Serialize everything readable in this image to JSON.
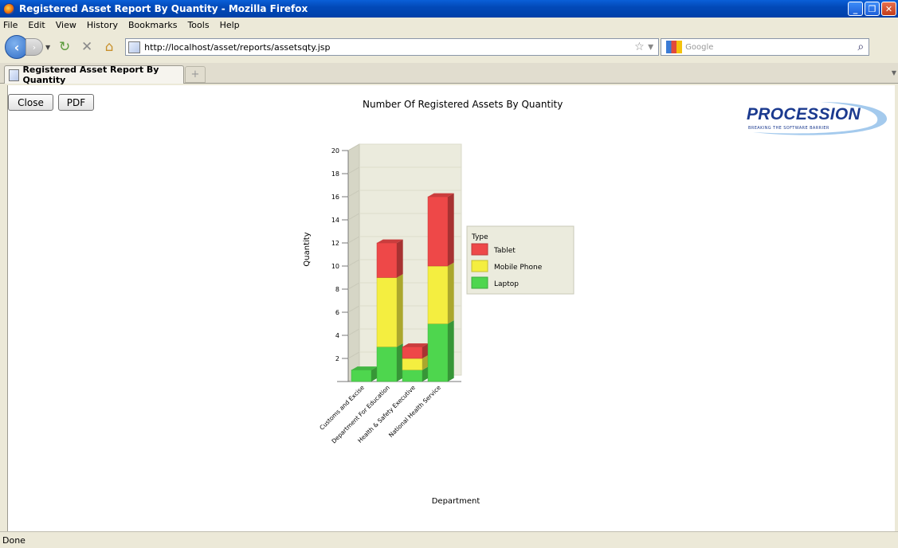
{
  "window": {
    "title": "Registered Asset Report By Quantity - Mozilla Firefox"
  },
  "menu": [
    "File",
    "Edit",
    "View",
    "History",
    "Bookmarks",
    "Tools",
    "Help"
  ],
  "nav": {
    "url": "http://localhost/asset/reports/assetsqty.jsp",
    "search_placeholder": "Google"
  },
  "tab": {
    "label": "Registered Asset Report By Quantity"
  },
  "page": {
    "close_label": "Close",
    "pdf_label": "PDF"
  },
  "logo": {
    "name": "PROCESSION",
    "tagline": "BREAKING THE SOFTWARE BARRIER"
  },
  "status": "Done",
  "chart_data": {
    "type": "bar",
    "stacked": true,
    "title": "Number Of Registered Assets By Quantity",
    "xlabel": "Department",
    "ylabel": "Quantity",
    "ylim": [
      0,
      20
    ],
    "yticks": [
      2,
      4,
      6,
      8,
      10,
      12,
      14,
      16,
      18,
      20
    ],
    "categories": [
      "Customs and Excise",
      "Department For Education",
      "Health & Safety Executive",
      "National Health Service"
    ],
    "legend_title": "Type",
    "legend_position": "right",
    "series": [
      {
        "name": "Laptop",
        "color": "#4ed64e",
        "values": [
          1,
          3,
          1,
          5
        ]
      },
      {
        "name": "Mobile Phone",
        "color": "#f4ee40",
        "values": [
          0,
          6,
          1,
          5
        ]
      },
      {
        "name": "Tablet",
        "color": "#ee4848",
        "values": [
          0,
          3,
          1,
          6
        ]
      }
    ],
    "legend_order": [
      "Tablet",
      "Mobile Phone",
      "Laptop"
    ]
  }
}
